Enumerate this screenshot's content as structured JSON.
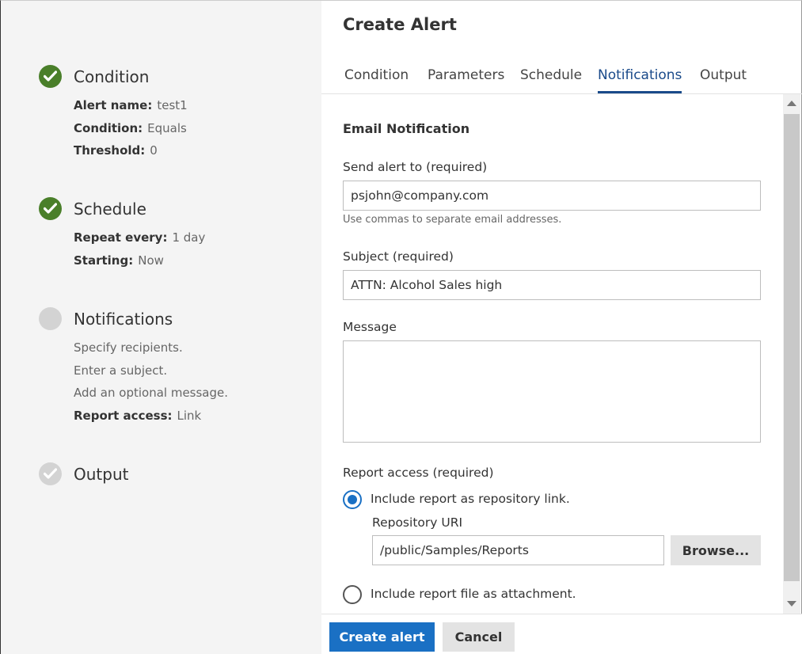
{
  "wizard": {
    "steps": [
      {
        "title": "Condition",
        "status": "complete",
        "details": [
          {
            "key": "Alert name:",
            "value": "test1"
          },
          {
            "key": "Condition:",
            "value": "Equals"
          },
          {
            "key": "Threshold:",
            "value": "0"
          }
        ]
      },
      {
        "title": "Schedule",
        "status": "complete",
        "details": [
          {
            "key": "Repeat every:",
            "value": "1 day"
          },
          {
            "key": "Starting:",
            "value": "Now"
          }
        ]
      },
      {
        "title": "Notifications",
        "status": "pending",
        "hints": [
          "Specify recipients.",
          "Enter a subject.",
          "Add an optional message."
        ],
        "details": [
          {
            "key": "Report access:",
            "value": "Link"
          }
        ]
      },
      {
        "title": "Output",
        "status": "faded"
      }
    ]
  },
  "dialog": {
    "title": "Create Alert",
    "tabs": [
      {
        "label": "Condition",
        "active": false
      },
      {
        "label": "Parameters",
        "active": false
      },
      {
        "label": "Schedule",
        "active": false
      },
      {
        "label": "Notifications",
        "active": true
      },
      {
        "label": "Output",
        "active": false
      }
    ]
  },
  "form": {
    "section_title": "Email Notification",
    "send_to_label": "Send alert to (required)",
    "send_to_value": "psjohn@company.com",
    "send_to_hint": "Use commas to separate email addresses.",
    "subject_label": "Subject (required)",
    "subject_value": "ATTN: Alcohol Sales high",
    "message_label": "Message",
    "message_value": "",
    "report_access_label": "Report access (required)",
    "option_link_label": "Include report as repository link.",
    "repository_uri_label": "Repository URI",
    "repository_uri_value": "/public/Samples/Reports",
    "browse_label": "Browse...",
    "option_attachment_label": "Include report file as attachment."
  },
  "footer": {
    "create_label": "Create alert",
    "cancel_label": "Cancel"
  },
  "colors": {
    "complete": "#4a7f2a",
    "pending": "#d3d3d3",
    "accent": "#1a70c4",
    "tab_active": "#1a4a8a"
  }
}
